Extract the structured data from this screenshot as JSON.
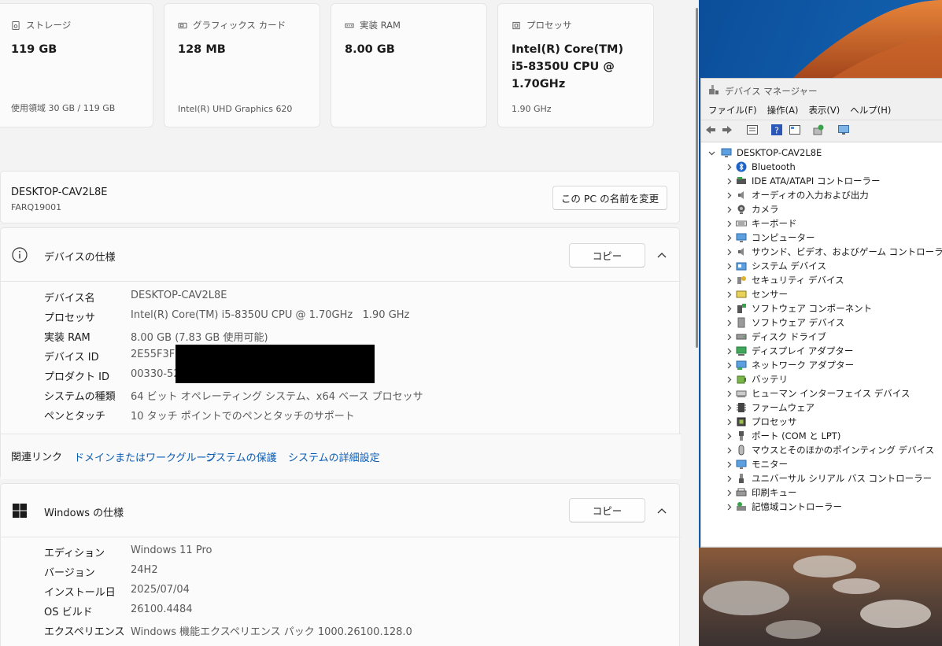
{
  "cards": [
    {
      "title": "ストレージ",
      "value": "119 GB",
      "sub": "使用領域 30 GB / 119 GB"
    },
    {
      "title": "グラフィックス カード",
      "value": "128 MB",
      "sub": "Intel(R) UHD Graphics 620"
    },
    {
      "title": "実装 RAM",
      "value": "8.00 GB",
      "sub": ""
    },
    {
      "title": "プロセッサ",
      "value": "Intel(R) Core(TM)\ni5-8350U CPU @\n1.70GHz",
      "sub": "1.90 GHz"
    }
  ],
  "pc": {
    "name": "DESKTOP-CAV2L8E",
    "model": "FARQ19001",
    "rename_button": "この PC の名前を変更"
  },
  "device_spec": {
    "title": "デバイスの仕様",
    "copy_button": "コピー",
    "rows": [
      {
        "label": "デバイス名",
        "value": "DESKTOP-CAV2L8E"
      },
      {
        "label": "プロセッサ",
        "value": "Intel(R) Core(TM) i5-8350U CPU @ 1.70GHz   1.90 GHz"
      },
      {
        "label": "実装 RAM",
        "value": "8.00 GB (7.83 GB 使用可能)"
      },
      {
        "label": "デバイス ID",
        "value": "2E55F3FB"
      },
      {
        "label": "プロダクト ID",
        "value": "00330-52"
      },
      {
        "label": "システムの種類",
        "value": "64 ビット オペレーティング システム、x64 ベース プロセッサ"
      },
      {
        "label": "ペンとタッチ",
        "value": "10 タッチ ポイントでのペンとタッチのサポート"
      }
    ]
  },
  "related": {
    "label": "関連リンク",
    "links": [
      "ドメインまたはワークグループ",
      "システムの保護",
      "システムの詳細設定"
    ]
  },
  "windows_spec": {
    "title": "Windows の仕様",
    "copy_button": "コピー",
    "rows": [
      {
        "label": "エディション",
        "value": "Windows 11 Pro"
      },
      {
        "label": "バージョン",
        "value": "24H2"
      },
      {
        "label": "インストール日",
        "value": "2025/07/04"
      },
      {
        "label": "OS ビルド",
        "value": "26100.4484"
      },
      {
        "label": "エクスペリエンス",
        "value": "Windows 機能エクスペリエンス パック 1000.26100.128.0"
      }
    ]
  },
  "device_manager": {
    "title": "デバイス マネージャー",
    "menu": [
      "ファイル(F)",
      "操作(A)",
      "表示(V)",
      "ヘルプ(H)"
    ],
    "root": "DESKTOP-CAV2L8E",
    "nodes": [
      {
        "label": "Bluetooth",
        "icon": "bluetooth-icon"
      },
      {
        "label": "IDE ATA/ATAPI コントローラー",
        "icon": "ide-controller-icon"
      },
      {
        "label": "オーディオの入力および出力",
        "icon": "speaker-icon"
      },
      {
        "label": "カメラ",
        "icon": "camera-icon"
      },
      {
        "label": "キーボード",
        "icon": "keyboard-icon"
      },
      {
        "label": "コンピューター",
        "icon": "computer-icon"
      },
      {
        "label": "サウンド、ビデオ、およびゲーム コントローラー",
        "icon": "sound-icon"
      },
      {
        "label": "システム デバイス",
        "icon": "system-device-icon"
      },
      {
        "label": "セキュリティ デバイス",
        "icon": "security-key-icon"
      },
      {
        "label": "センサー",
        "icon": "sensor-icon"
      },
      {
        "label": "ソフトウェア コンポーネント",
        "icon": "software-component-icon"
      },
      {
        "label": "ソフトウェア デバイス",
        "icon": "software-device-icon"
      },
      {
        "label": "ディスク ドライブ",
        "icon": "disk-drive-icon"
      },
      {
        "label": "ディスプレイ アダプター",
        "icon": "display-adapter-icon"
      },
      {
        "label": "ネットワーク アダプター",
        "icon": "network-adapter-icon"
      },
      {
        "label": "バッテリ",
        "icon": "battery-icon"
      },
      {
        "label": "ヒューマン インターフェイス デバイス",
        "icon": "hid-icon"
      },
      {
        "label": "ファームウェア",
        "icon": "firmware-icon"
      },
      {
        "label": "プロセッサ",
        "icon": "processor-icon"
      },
      {
        "label": "ポート (COM と LPT)",
        "icon": "port-icon"
      },
      {
        "label": "マウスとそのほかのポインティング デバイス",
        "icon": "mouse-icon"
      },
      {
        "label": "モニター",
        "icon": "monitor-icon"
      },
      {
        "label": "ユニバーサル シリアル バス コントローラー",
        "icon": "usb-icon"
      },
      {
        "label": "印刷キュー",
        "icon": "printer-icon"
      },
      {
        "label": "記憶域コントローラー",
        "icon": "storage-controller-icon"
      }
    ]
  },
  "colors": {
    "accent_link": "#0a5db5",
    "card_bg": "#fbfbfb",
    "page_bg": "#f3f3f3"
  }
}
